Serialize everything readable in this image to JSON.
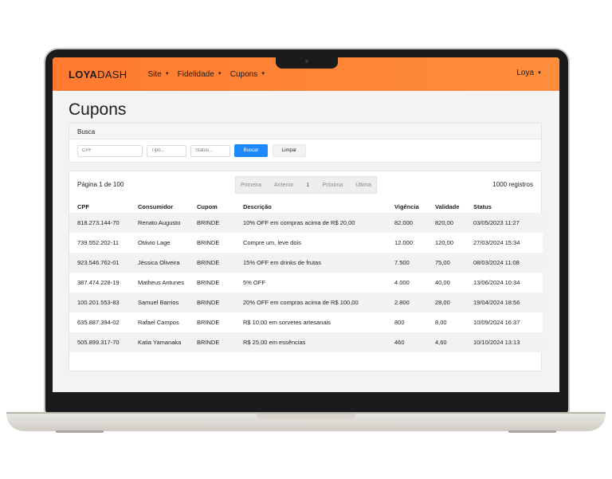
{
  "navbar": {
    "brand_bold": "LOYA",
    "brand_thin": "DASH",
    "items": [
      {
        "label": "Site"
      },
      {
        "label": "Fidelidade"
      },
      {
        "label": "Cupons"
      }
    ],
    "user": "Loya",
    "accent": "#ff7a2f"
  },
  "page": {
    "title": "Cupons"
  },
  "search": {
    "header": "Busca",
    "cpf_placeholder": "CPF",
    "tipo_placeholder": "Tipo...",
    "status_placeholder": "Status...",
    "search_button": "Buscar",
    "clear_button": "Limpar",
    "primary_color": "#1e88ff"
  },
  "table": {
    "page_info": "Página 1 de 100",
    "records": "1000 registros",
    "pager": {
      "first": "Primeira",
      "prev": "Anterior",
      "current": "1",
      "next": "Próxima",
      "last": "Última"
    },
    "columns": [
      "CPF",
      "Consumidor",
      "Cupom",
      "Descrição",
      "Vigência",
      "Validade",
      "Status"
    ],
    "rows": [
      [
        "818.273.144-70",
        "Renato Augusto",
        "BRINDE",
        "10% OFF em compras acima de R$ 20,00",
        "82.000",
        "820,00",
        "03/05/2023 11:27"
      ],
      [
        "739.552.202-11",
        "Otávio Lage",
        "BRINDE",
        "Compre um, leve dois",
        "12.000",
        "120,00",
        "27/03/2024 15:34"
      ],
      [
        "923.546.762-01",
        "Jéssica Oliveira",
        "BRINDE",
        "15% OFF em drinks de frutas",
        "7.500",
        "75,00",
        "08/03/2024 11:08"
      ],
      [
        "387.474.228-19",
        "Matheus Antunes",
        "BRINDE",
        "5% OFF",
        "4.000",
        "40,00",
        "13/06/2024 10:34"
      ],
      [
        "100.201.553-83",
        "Samuel Barrios",
        "BRINDE",
        "20% OFF em compras acima de R$ 100,00",
        "2.800",
        "28,00",
        "19/04/2024 18:56"
      ],
      [
        "635.887.394-02",
        "Rafael Campos",
        "BRINDE",
        "R$ 10,00 em sorvetes artesanais",
        "800",
        "8,00",
        "10/09/2024 16:37"
      ],
      [
        "505.899.317-70",
        "Katia Yamanaka",
        "BRINDE",
        "R$ 25,00 em essências",
        "460",
        "4,60",
        "10/10/2024 13:13"
      ]
    ]
  }
}
